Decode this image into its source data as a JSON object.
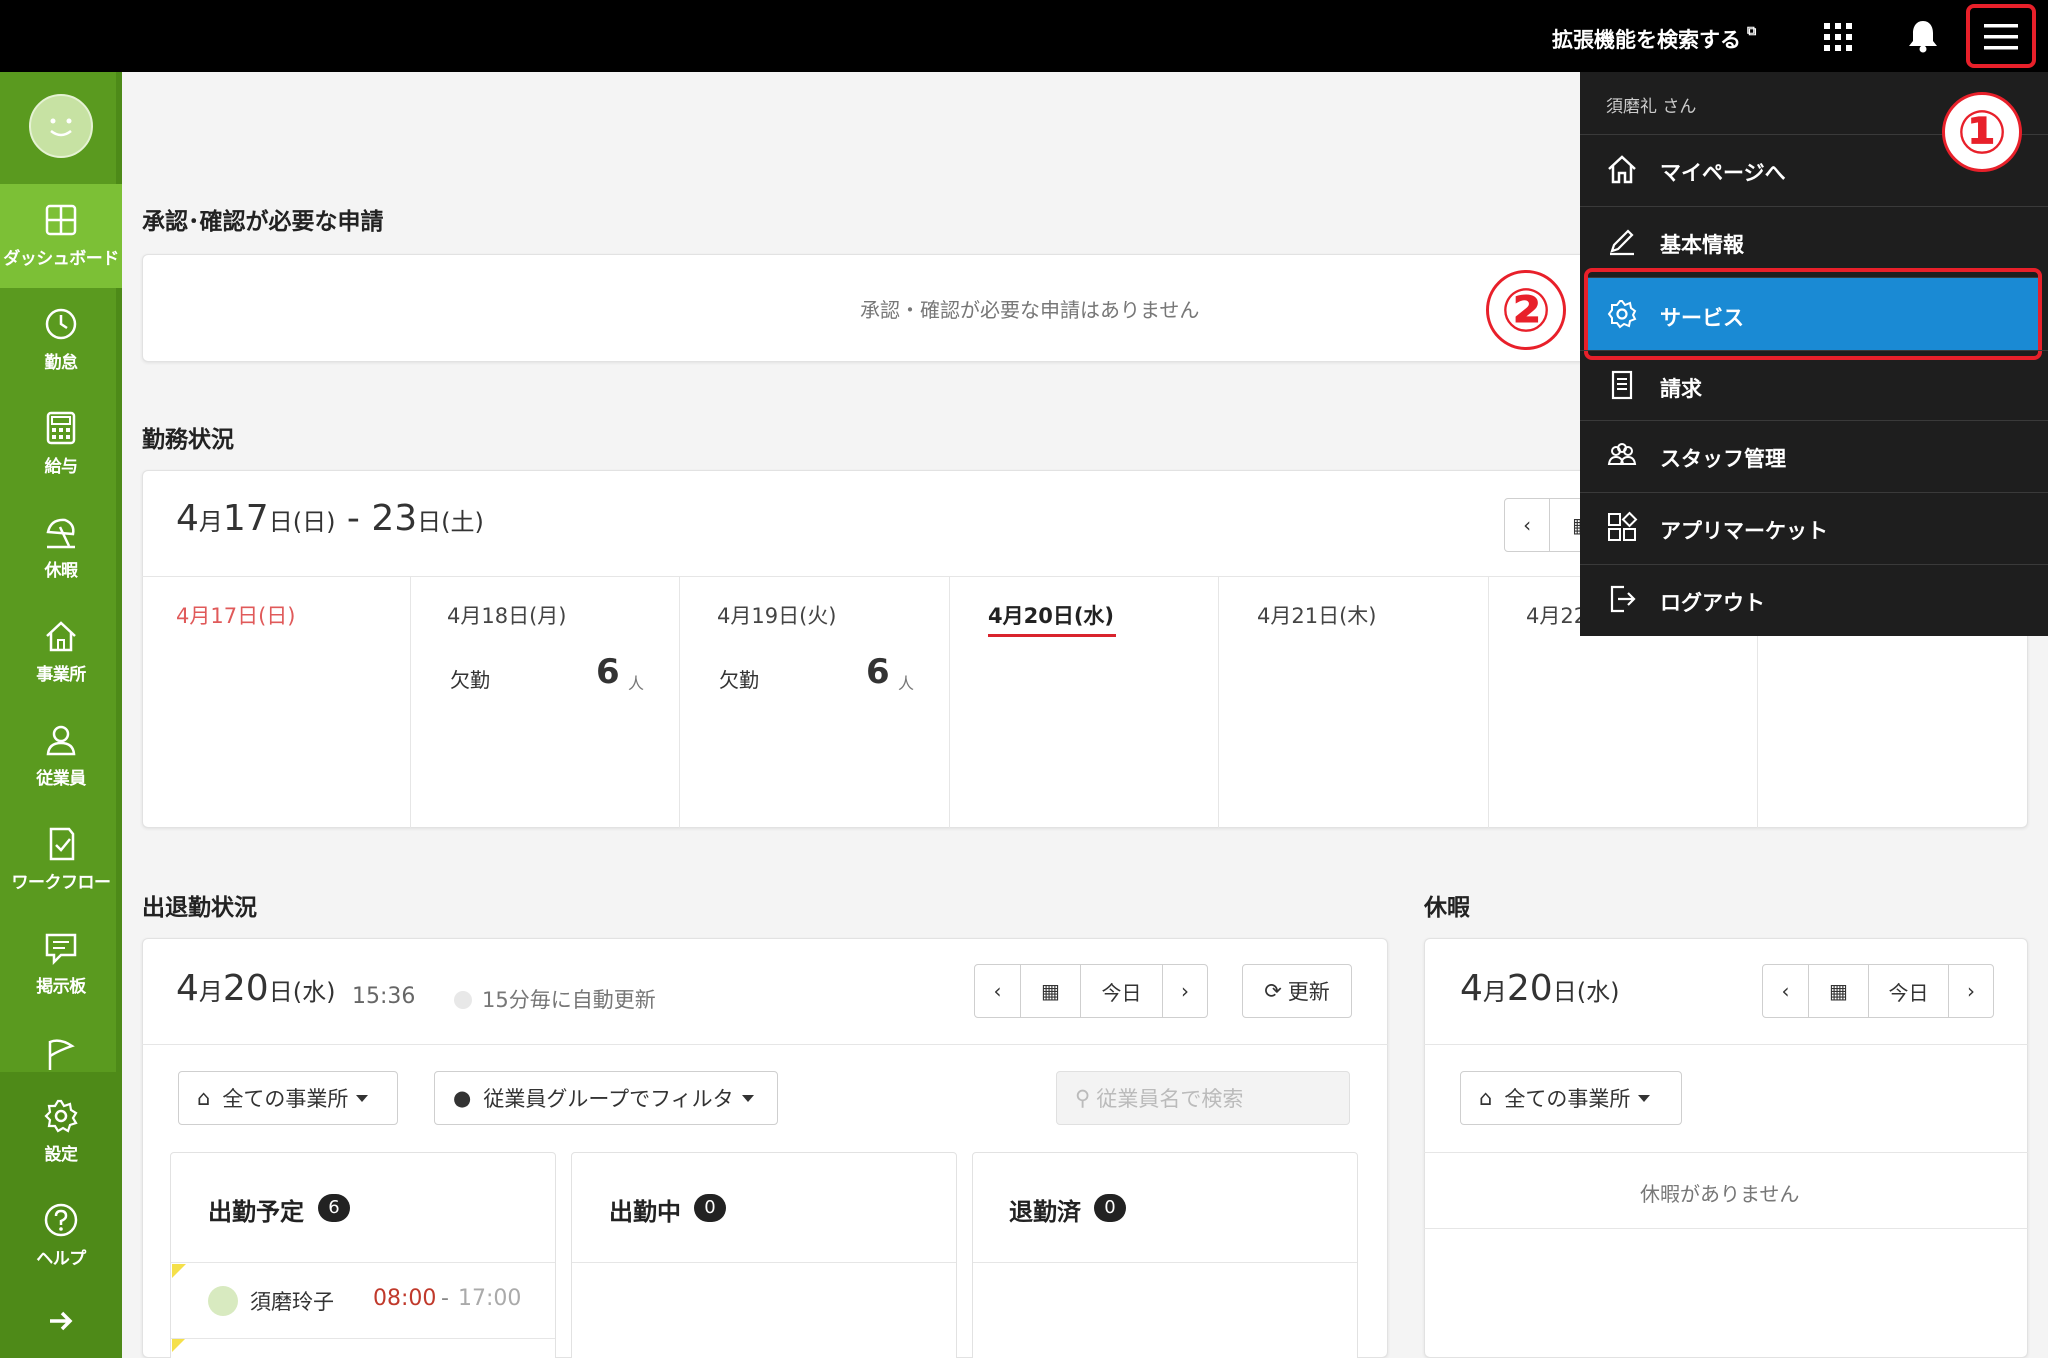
{
  "topbar": {
    "ext_search": "拡張機能を検索する",
    "ext_mark": "⧉"
  },
  "sidebar": {
    "items": [
      {
        "label": "ダッシュボード",
        "icon": "dashboard-icon"
      },
      {
        "label": "勤怠",
        "icon": "clock-icon"
      },
      {
        "label": "給与",
        "icon": "calculator-icon"
      },
      {
        "label": "休暇",
        "icon": "parasol-icon"
      },
      {
        "label": "事業所",
        "icon": "office-icon"
      },
      {
        "label": "従業員",
        "icon": "person-icon"
      },
      {
        "label": "ワークフロー",
        "icon": "workflow-icon"
      },
      {
        "label": "掲示板",
        "icon": "board-icon"
      },
      {
        "label": "設定",
        "icon": "gear-icon"
      },
      {
        "label": "ヘルプ",
        "icon": "help-icon"
      }
    ],
    "active": "ダッシュボード",
    "colors": {
      "bg": "#5a9a1f",
      "active": "#7cc036"
    }
  },
  "approvals": {
    "title": "承認･確認が必要な申請",
    "empty": "承認・確認が必要な申請はありません"
  },
  "work_status": {
    "title": "勤務状況",
    "range_day1": "4",
    "range_m1": "月",
    "range_d1": "17",
    "range_w1": "日(日)",
    "range_sep": " - ",
    "range_d2": "23",
    "range_w2": "日(土)",
    "days": [
      {
        "label": "4月17日(日)"
      },
      {
        "label": "4月18日(月)",
        "absent_label": "欠勤",
        "absent_count": "6",
        "unit": "人"
      },
      {
        "label": "4月19日(火)",
        "absent_label": "欠勤",
        "absent_count": "6",
        "unit": "人"
      },
      {
        "label": "4月20日(水)"
      },
      {
        "label": "4月21日(木)"
      },
      {
        "label": "4月22"
      }
    ]
  },
  "attendance": {
    "title": "出退勤状況",
    "date_day": "4",
    "date_month": "月",
    "date_num": "20",
    "date_week": "日(水)",
    "time": "15:36",
    "auto_refresh": "15分毎に自動更新",
    "today_btn": "今日",
    "refresh_btn": "更新",
    "office_filter": "全ての事業所",
    "group_filter": "従業員グループでフィルタ",
    "search_placeholder": "従業員名で検索",
    "columns": [
      {
        "title": "出勤予定",
        "count": "6"
      },
      {
        "title": "出勤中",
        "count": "0"
      },
      {
        "title": "退勤済",
        "count": "0"
      }
    ],
    "employee": {
      "name": "須磨玲子",
      "start": "08:00",
      "sep": "-",
      "end": "17:00"
    }
  },
  "vacation": {
    "title": "休暇",
    "date_day": "4",
    "date_month": "月",
    "date_num": "20",
    "date_week": "日(水)",
    "today_btn": "今日",
    "office_filter": "全ての事業所",
    "empty": "休暇がありません"
  },
  "menu": {
    "user": "須磨礼 さん",
    "items": [
      {
        "label": "マイページへ",
        "icon": "home-icon"
      },
      {
        "label": "基本情報",
        "icon": "pencil-icon"
      },
      {
        "label": "サービス",
        "icon": "gear-icon"
      },
      {
        "label": "請求",
        "icon": "document-icon"
      },
      {
        "label": "スタッフ管理",
        "icon": "staff-icon"
      },
      {
        "label": "アプリマーケット",
        "icon": "apps-market-icon"
      },
      {
        "label": "ログアウト",
        "icon": "logout-icon"
      }
    ],
    "highlight_color": "#1a8ad4"
  },
  "callouts": {
    "one": "①",
    "two": "②"
  }
}
